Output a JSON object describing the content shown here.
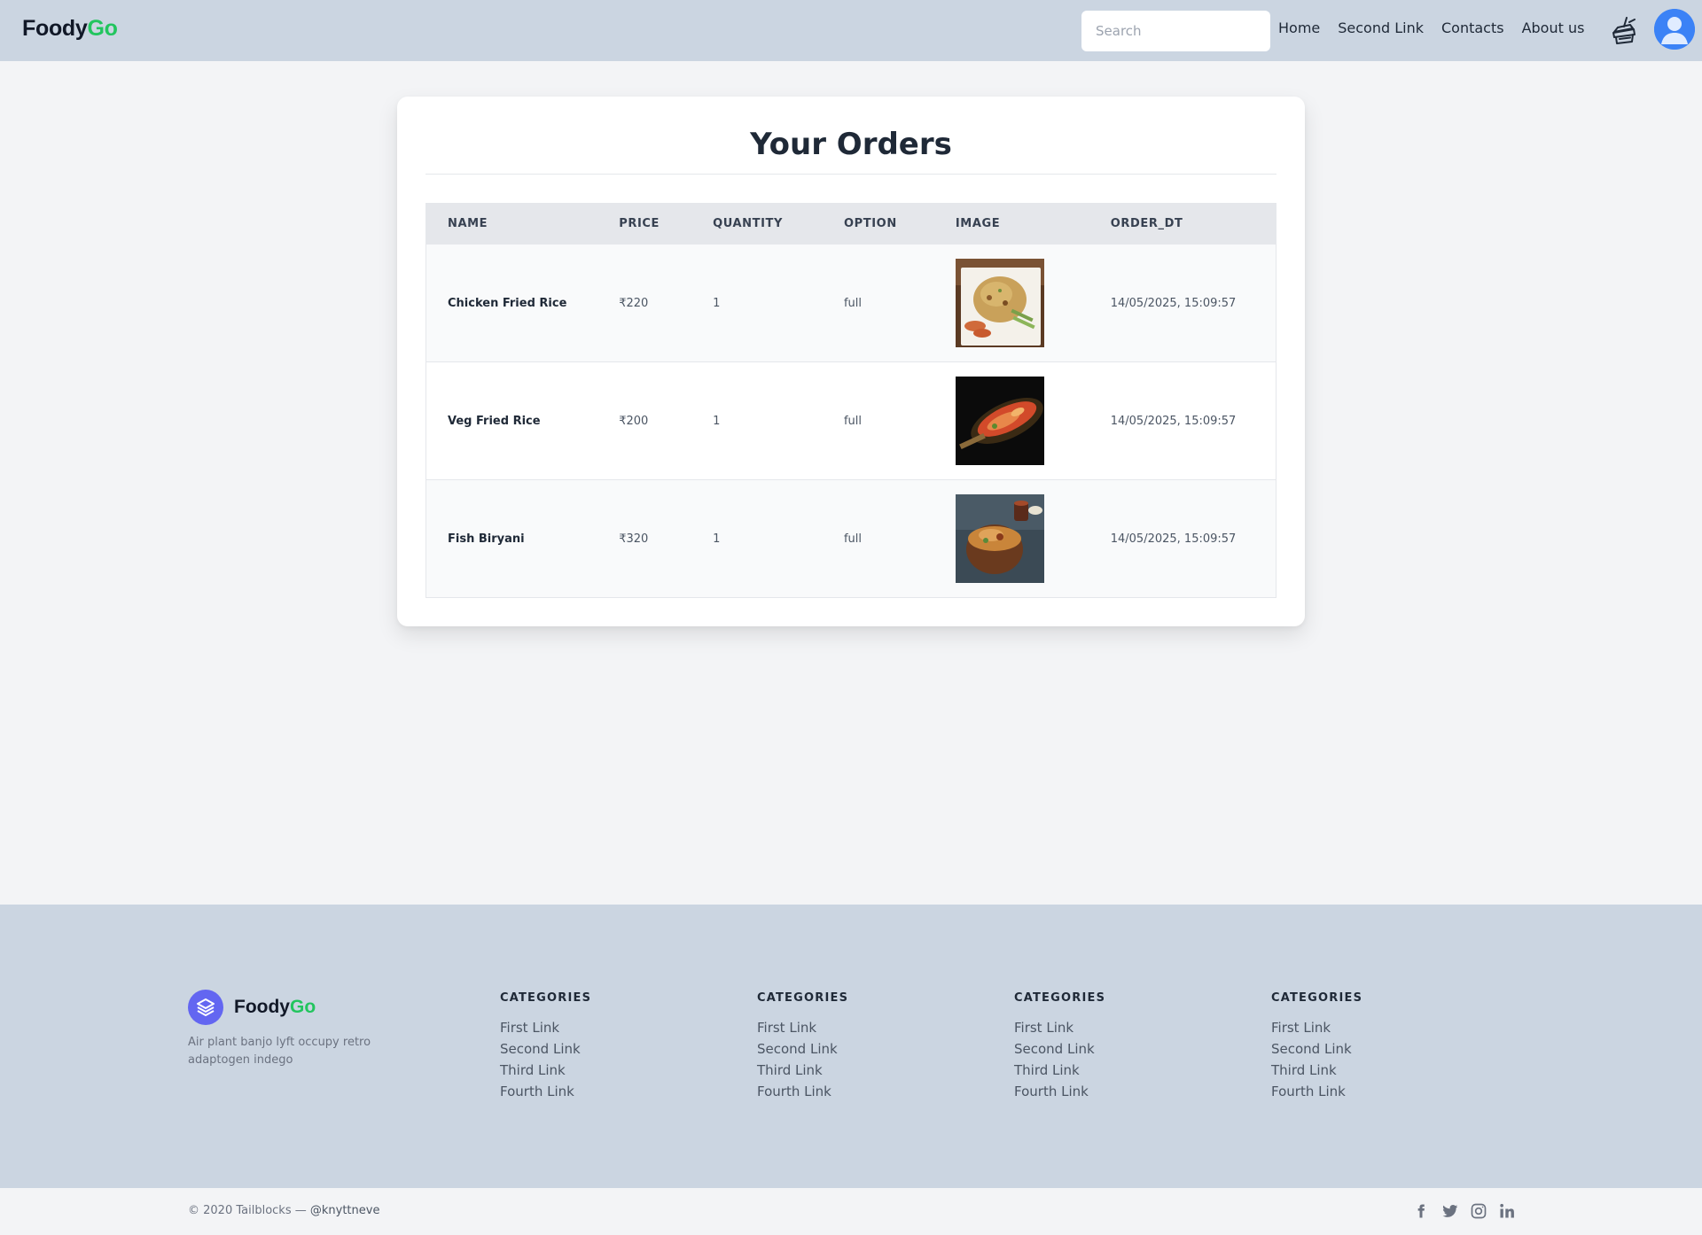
{
  "header": {
    "brand_part1": "Foody",
    "brand_part2": "Go",
    "search_placeholder": "Search",
    "nav": [
      {
        "label": "Home"
      },
      {
        "label": "Second Link"
      },
      {
        "label": "Contacts"
      },
      {
        "label": "About us"
      }
    ],
    "icons": [
      "food-cart-icon",
      "user-avatar-icon"
    ]
  },
  "orders": {
    "title": "Your Orders",
    "columns": [
      "NAME",
      "PRICE",
      "QUANTITY",
      "OPTION",
      "IMAGE",
      "ORDER_DT"
    ],
    "rows": [
      {
        "name": "Chicken Fried Rice",
        "price": "₹220",
        "quantity": "1",
        "option": "full",
        "image": "chicken-fried-rice-image",
        "order_dt": "14/05/2025, 15:09:57"
      },
      {
        "name": "Veg Fried Rice",
        "price": "₹200",
        "quantity": "1",
        "option": "full",
        "image": "veg-fried-rice-image",
        "order_dt": "14/05/2025, 15:09:57"
      },
      {
        "name": "Fish Biryani",
        "price": "₹320",
        "quantity": "1",
        "option": "full",
        "image": "fish-biryani-image",
        "order_dt": "14/05/2025, 15:09:57"
      }
    ]
  },
  "footer": {
    "brand_part1": "Foody",
    "brand_part2": "Go",
    "tagline": "Air plant banjo lyft occupy retro adaptogen indego",
    "columns": [
      {
        "heading": "CATEGORIES",
        "links": [
          "First Link",
          "Second Link",
          "Third Link",
          "Fourth Link"
        ]
      },
      {
        "heading": "CATEGORIES",
        "links": [
          "First Link",
          "Second Link",
          "Third Link",
          "Fourth Link"
        ]
      },
      {
        "heading": "CATEGORIES",
        "links": [
          "First Link",
          "Second Link",
          "Third Link",
          "Fourth Link"
        ]
      },
      {
        "heading": "CATEGORIES",
        "links": [
          "First Link",
          "Second Link",
          "Third Link",
          "Fourth Link"
        ]
      }
    ],
    "copyright": "© 2020 Tailblocks —",
    "handle": "@knyttneve",
    "social_icons": [
      "facebook-icon",
      "twitter-icon",
      "instagram-icon",
      "linkedin-icon"
    ]
  },
  "colors": {
    "header_bg": "#cbd5e1",
    "page_bg": "#f3f4f6",
    "brand_accent": "#22c55e",
    "logo_circle": "#6366f1",
    "avatar": "#3b82f6"
  }
}
